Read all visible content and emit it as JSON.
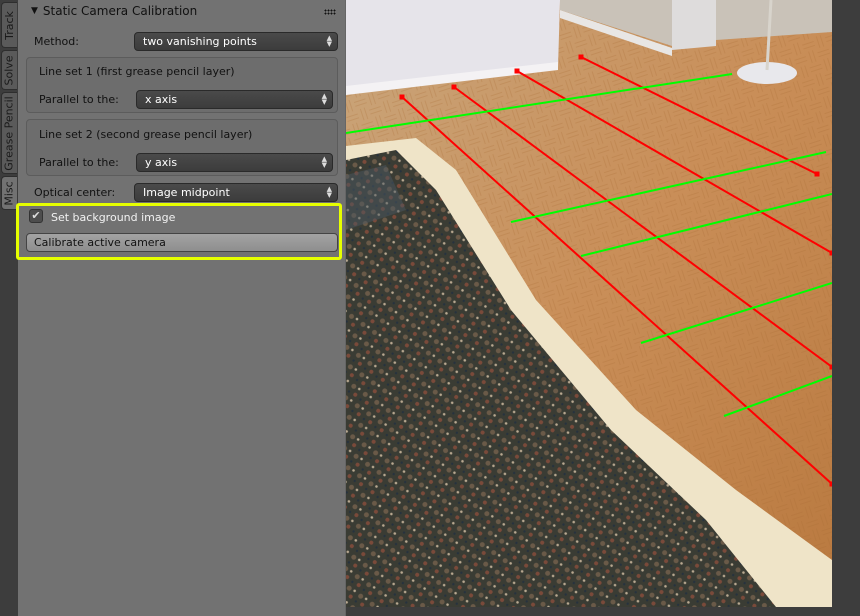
{
  "tabs": [
    {
      "label": "Track",
      "active": false
    },
    {
      "label": "Solve",
      "active": false
    },
    {
      "label": "Grease Pencil",
      "active": false
    },
    {
      "label": "Misc",
      "active": true
    }
  ],
  "panel": {
    "title": "Static Camera Calibration",
    "method_label": "Method:",
    "method_value": "two vanishing points",
    "line_set_1": {
      "title": "Line set 1 (first grease pencil layer)",
      "parallel_label": "Parallel to the:",
      "parallel_value": "x axis"
    },
    "line_set_2": {
      "title": "Line set 2 (second grease pencil layer)",
      "parallel_label": "Parallel to the:",
      "parallel_value": "y axis"
    },
    "optical_center_label": "Optical center:",
    "optical_center_value": "Image midpoint",
    "set_background_label": "Set background image",
    "set_background_checked": true,
    "calibrate_button": "Calibrate active camera"
  },
  "viewport": {
    "content": "camera background photo of parquet floor with rug",
    "annotation_colors": {
      "line_set_1": "#ff0000",
      "line_set_2": "#00ff00"
    },
    "highlight_color": "#e6ff00"
  }
}
